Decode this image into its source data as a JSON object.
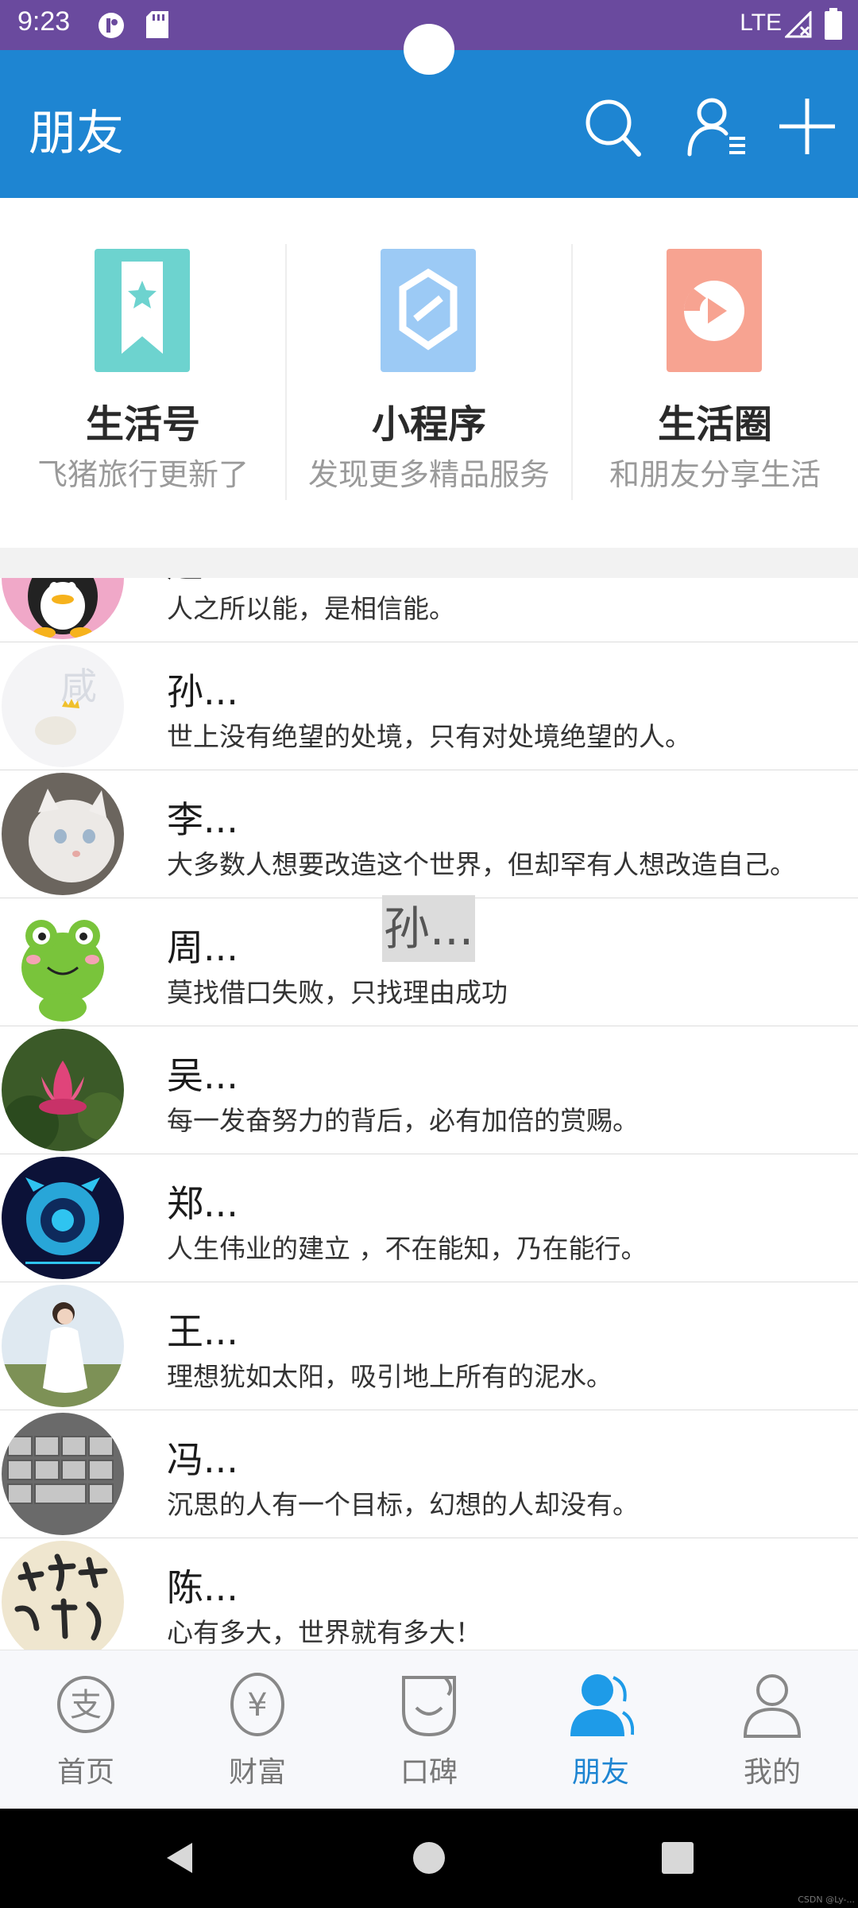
{
  "status_bar": {
    "time": "9:23",
    "network": "LTE"
  },
  "app_bar": {
    "title": "朋友",
    "icons": [
      "search-icon",
      "contacts-icon",
      "add-icon"
    ]
  },
  "features": [
    {
      "title": "生活号",
      "subtitle": "飞猪旅行更新了",
      "icon": "bookmark-star-icon",
      "color": "#6dd3cf"
    },
    {
      "title": "小程序",
      "subtitle": "发现更多精品服务",
      "icon": "mini-program-icon",
      "color": "#9ccaf5"
    },
    {
      "title": "生活圈",
      "subtitle": "和朋友分享生活",
      "icon": "life-circle-icon",
      "color": "#f7a391"
    }
  ],
  "friends": [
    {
      "name": "赵...",
      "motto": "人之所以能，是相信能。"
    },
    {
      "name": "孙...",
      "motto": "世上没有绝望的处境，只有对处境绝望的人。"
    },
    {
      "name": "李...",
      "motto": "大多数人想要改造这个世界，但却罕有人想改造自己。"
    },
    {
      "name": "周...",
      "motto": "莫找借口失败，只找理由成功"
    },
    {
      "name": "吴...",
      "motto": "每一发奋努力的背后，必有加倍的赏赐。"
    },
    {
      "name": "郑...",
      "motto": "人生伟业的建立 ，不在能知，乃在能行。"
    },
    {
      "name": "王...",
      "motto": "理想犹如太阳，吸引地上所有的泥水。"
    },
    {
      "name": "冯...",
      "motto": "沉思的人有一个目标，幻想的人却没有。"
    },
    {
      "name": "陈...",
      "motto": "心有多大，世界就有多大！"
    }
  ],
  "overlay": {
    "text": "孙..."
  },
  "tabs": [
    {
      "label": "首页",
      "icon": "alipay-icon",
      "active": false
    },
    {
      "label": "财富",
      "icon": "yuan-icon",
      "active": false
    },
    {
      "label": "口碑",
      "icon": "koubei-icon",
      "active": false
    },
    {
      "label": "朋友",
      "icon": "friends-icon",
      "active": true
    },
    {
      "label": "我的",
      "icon": "person-icon",
      "active": false
    }
  ],
  "watermark": "CSDN @Ly-...",
  "colors": {
    "app_bar": "#1e85d2",
    "status_bar": "#6a4a9e",
    "active_tab": "#1e85d2"
  }
}
